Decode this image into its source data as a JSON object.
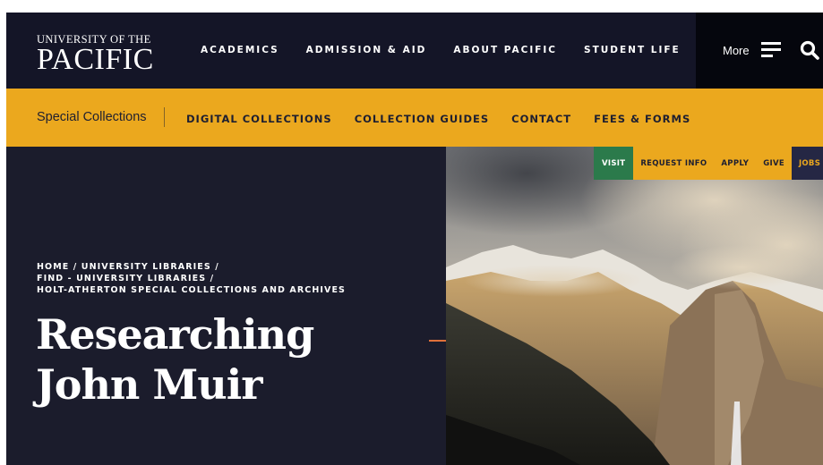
{
  "logo": {
    "top": "UNIVERSITY OF THE",
    "main": "PACIFIC"
  },
  "main_nav": [
    "ACADEMICS",
    "ADMISSION & AID",
    "ABOUT PACIFIC",
    "STUDENT LIFE"
  ],
  "more_label": "More",
  "section": {
    "title": "Special Collections",
    "links": [
      "DIGITAL COLLECTIONS",
      "COLLECTION GUIDES",
      "CONTACT",
      "FEES & FORMS"
    ]
  },
  "utility": [
    "VISIT",
    "REQUEST INFO",
    "APPLY",
    "GIVE",
    "JOBS"
  ],
  "breadcrumb": [
    "HOME",
    "UNIVERSITY LIBRARIES",
    "FIND - UNIVERSITY LIBRARIES",
    "HOLT-ATHERTON SPECIAL COLLECTIONS AND ARCHIVES"
  ],
  "page_title": {
    "line1": "Researching",
    "line2": "John Muir"
  },
  "colors": {
    "navy": "#141527",
    "gold": "#eba81e",
    "green": "#2b7a4b",
    "accent": "#e0703a"
  }
}
